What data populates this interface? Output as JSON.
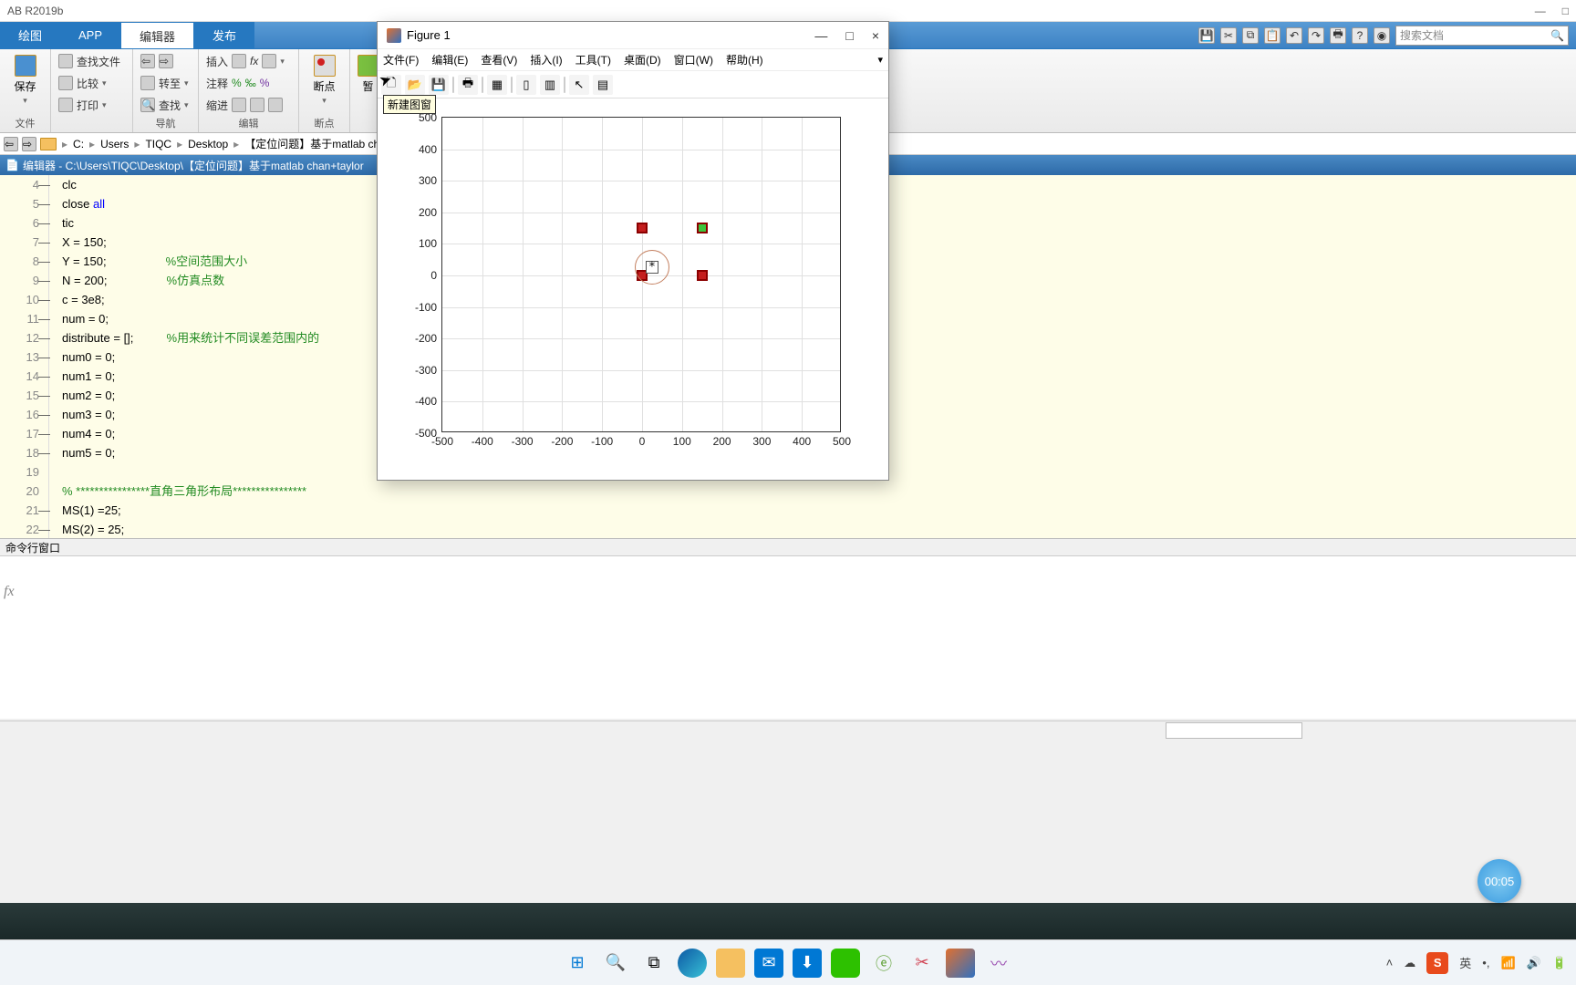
{
  "app": {
    "title": "AB R2019b"
  },
  "window_controls": {
    "min": "—",
    "max": "□",
    "close": "×"
  },
  "tabs": {
    "plot": "绘图",
    "app": "APP",
    "editor": "编辑器",
    "publish": "发布"
  },
  "qat_search_placeholder": "搜索文档",
  "ribbon": {
    "file_group": "文件",
    "nav_group": "导航",
    "edit_group": "编辑",
    "breakpoint_group": "断点",
    "save": "保存",
    "compare": "比较",
    "print": "打印",
    "find_files": "查找文件",
    "goto": "转至",
    "find": "查找",
    "insert": "插入",
    "comment": "注释",
    "indent": "缩进",
    "breakpoint": "断点",
    "pause": "暂"
  },
  "breadcrumb": [
    "C:",
    "Users",
    "TIQC",
    "Desktop",
    "【定位问题】基于matlab ch"
  ],
  "editor_title": "编辑器 - C:\\Users\\TIQC\\Desktop\\【定位问题】基于matlab chan+taylor",
  "code": {
    "start_line": 4,
    "lines": [
      {
        "n": 4,
        "dash": true,
        "text": "clc"
      },
      {
        "n": 5,
        "dash": true,
        "text": "close ",
        "kw": "all"
      },
      {
        "n": 6,
        "dash": true,
        "text": "tic"
      },
      {
        "n": 7,
        "dash": true,
        "text": "X = 150;"
      },
      {
        "n": 8,
        "dash": true,
        "text": "Y = 150;",
        "cmt": "                  %空间范围大小"
      },
      {
        "n": 9,
        "dash": true,
        "text": "N = 200;",
        "cmt": "                  %仿真点数"
      },
      {
        "n": 10,
        "dash": true,
        "text": "c = 3e8;"
      },
      {
        "n": 11,
        "dash": true,
        "text": "num = 0;"
      },
      {
        "n": 12,
        "dash": true,
        "text": "distribute = [];",
        "cmt": "          %用来统计不同误差范围内的"
      },
      {
        "n": 13,
        "dash": true,
        "text": "num0 = 0;"
      },
      {
        "n": 14,
        "dash": true,
        "text": "num1 = 0;"
      },
      {
        "n": 15,
        "dash": true,
        "text": "num2 = 0;"
      },
      {
        "n": 16,
        "dash": true,
        "text": "num3 = 0;"
      },
      {
        "n": 17,
        "dash": true,
        "text": "num4 = 0;"
      },
      {
        "n": 18,
        "dash": true,
        "text": "num5 = 0;"
      },
      {
        "n": 19,
        "dash": false,
        "text": ""
      },
      {
        "n": 20,
        "dash": false,
        "cmt": "% ****************直角三角形布局****************"
      },
      {
        "n": 21,
        "dash": true,
        "text": "MS(1) =25;"
      },
      {
        "n": 22,
        "dash": true,
        "text": "MS(2) = 25;"
      }
    ]
  },
  "cmd_title": "命令行窗口",
  "figure": {
    "title": "Figure 1",
    "menus": [
      "文件(F)",
      "编辑(E)",
      "查看(V)",
      "插入(I)",
      "工具(T)",
      "桌面(D)",
      "窗口(W)",
      "帮助(H)"
    ],
    "tooltip": "新建图窗"
  },
  "chart_data": {
    "type": "scatter",
    "xlim": [
      -500,
      500
    ],
    "ylim": [
      -500,
      500
    ],
    "xticks": [
      -500,
      -400,
      -300,
      -200,
      -100,
      0,
      100,
      200,
      300,
      400,
      500
    ],
    "yticks": [
      -500,
      -400,
      -300,
      -200,
      -100,
      0,
      100,
      200,
      300,
      400,
      500
    ],
    "series": [
      {
        "name": "red-squares",
        "points": [
          [
            0,
            150
          ],
          [
            0,
            0
          ],
          [
            150,
            0
          ]
        ],
        "color": "#c41e1e"
      },
      {
        "name": "green-square",
        "points": [
          [
            150,
            150
          ]
        ],
        "color": "#3cc43c"
      },
      {
        "name": "estimate-box",
        "points": [
          [
            25,
            25
          ]
        ],
        "style": "white-square"
      },
      {
        "name": "estimate-star",
        "points": [
          [
            25,
            25
          ]
        ],
        "style": "star"
      },
      {
        "name": "circle",
        "points": [
          [
            25,
            25
          ]
        ],
        "style": "ring",
        "radius": 45
      }
    ]
  },
  "timer": "00:05",
  "ime": {
    "logo": "S",
    "lang": "英"
  }
}
